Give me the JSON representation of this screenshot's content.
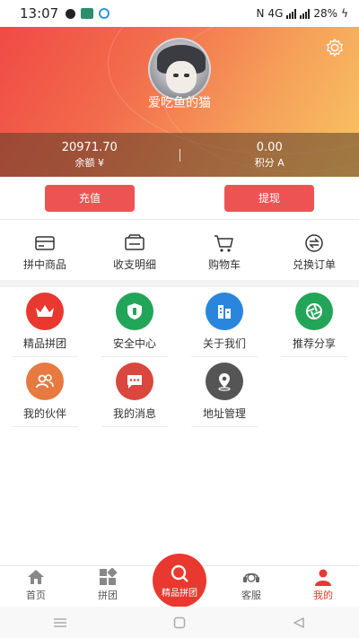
{
  "status": {
    "time": "13:07",
    "battery": "28%",
    "network": "4G"
  },
  "profile": {
    "username": "爱吃鱼的猫"
  },
  "balance": {
    "amount": "20971.70",
    "amount_label": "余额 ¥",
    "points": "0.00",
    "points_label": "积分 A"
  },
  "actions": {
    "recharge": "充值",
    "withdraw": "提现"
  },
  "quick": [
    "拼中商品",
    "收支明细",
    "购物车",
    "兑换订单"
  ],
  "grid": [
    {
      "label": "精品拼团",
      "icon": "crown-icon",
      "color": "#e8382f"
    },
    {
      "label": "安全中心",
      "icon": "shield-icon",
      "color": "#22a559"
    },
    {
      "label": "关于我们",
      "icon": "building-icon",
      "color": "#2a86dc"
    },
    {
      "label": "推荐分享",
      "icon": "aperture-icon",
      "color": "#22a559"
    },
    {
      "label": "我的伙伴",
      "icon": "people-icon",
      "color": "#e67a40"
    },
    {
      "label": "我的消息",
      "icon": "chat-icon",
      "color": "#d9473e"
    },
    {
      "label": "地址管理",
      "icon": "location-icon",
      "color": "#555555"
    }
  ],
  "tabs": {
    "home": "首页",
    "group": "拼团",
    "featured": "精品拼团",
    "service": "客服",
    "mine": "我的"
  },
  "colors": {
    "accent": "#e8382f",
    "button": "#ee5353"
  }
}
